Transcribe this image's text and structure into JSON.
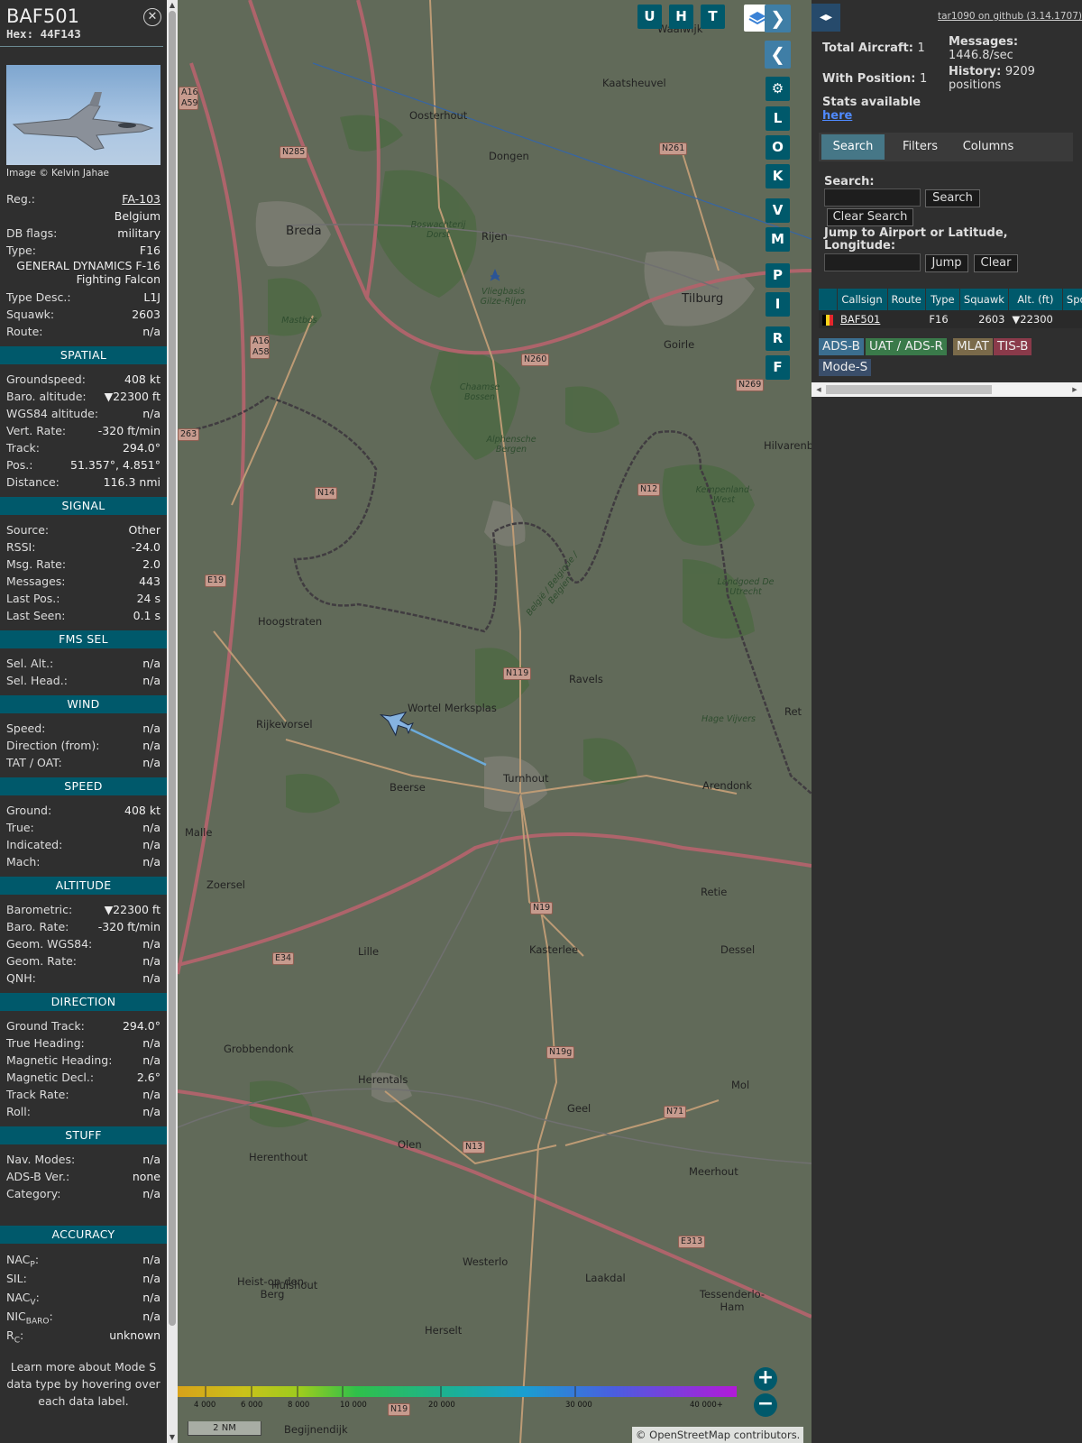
{
  "aircraft": {
    "callsign": "BAF501",
    "hex_label": "Hex: 44F143",
    "photo_credit": "Image © Kelvin Jahae",
    "rows_main": [
      {
        "label": "Reg.:",
        "value": "FA-103",
        "link": true
      },
      {
        "label": "",
        "value": "Belgium"
      },
      {
        "label": "DB flags:",
        "value": "military"
      },
      {
        "label": "Type:",
        "value": "F16"
      }
    ],
    "type_full": "GENERAL DYNAMICS F-16 Fighting Falcon",
    "rows_main2": [
      {
        "label": "Type Desc.:",
        "value": "L1J"
      },
      {
        "label": "Squawk:",
        "value": "2603"
      },
      {
        "label": "Route:",
        "value": "n/a"
      }
    ],
    "sections": [
      {
        "title": "SPATIAL",
        "rows": [
          {
            "label": "Groundspeed:",
            "value": "408 kt"
          },
          {
            "label": "Baro. altitude:",
            "value": "▼22300 ft"
          },
          {
            "label": "WGS84 altitude:",
            "value": "n/a"
          },
          {
            "label": "Vert. Rate:",
            "value": "-320 ft/min"
          },
          {
            "label": "Track:",
            "value": "294.0°"
          },
          {
            "label": "Pos.:",
            "value": "51.357°, 4.851°"
          },
          {
            "label": "Distance:",
            "value": "116.3 nmi"
          }
        ]
      },
      {
        "title": "SIGNAL",
        "rows": [
          {
            "label": "Source:",
            "value": "Other"
          },
          {
            "label": "RSSI:",
            "value": "-24.0"
          },
          {
            "label": "Msg. Rate:",
            "value": "2.0"
          },
          {
            "label": "Messages:",
            "value": "443"
          },
          {
            "label": "Last Pos.:",
            "value": "24 s"
          },
          {
            "label": "Last Seen:",
            "value": "0.1 s"
          }
        ]
      },
      {
        "title": "FMS SEL",
        "rows": [
          {
            "label": "Sel. Alt.:",
            "value": "n/a"
          },
          {
            "label": "Sel. Head.:",
            "value": "n/a"
          }
        ]
      },
      {
        "title": "WIND",
        "rows": [
          {
            "label": "Speed:",
            "value": "n/a"
          },
          {
            "label": "Direction (from):",
            "value": "n/a"
          },
          {
            "label": "TAT / OAT:",
            "value": "n/a"
          }
        ]
      },
      {
        "title": "SPEED",
        "rows": [
          {
            "label": "Ground:",
            "value": "408 kt"
          },
          {
            "label": "True:",
            "value": "n/a"
          },
          {
            "label": "Indicated:",
            "value": "n/a"
          },
          {
            "label": "Mach:",
            "value": "n/a"
          }
        ]
      },
      {
        "title": "ALTITUDE",
        "rows": [
          {
            "label": "Barometric:",
            "value": "▼22300 ft"
          },
          {
            "label": "Baro. Rate:",
            "value": "-320 ft/min"
          },
          {
            "label": "Geom. WGS84:",
            "value": "n/a"
          },
          {
            "label": "Geom. Rate:",
            "value": "n/a"
          },
          {
            "label": "QNH:",
            "value": "n/a"
          }
        ]
      },
      {
        "title": "DIRECTION",
        "rows": [
          {
            "label": "Ground Track:",
            "value": "294.0°"
          },
          {
            "label": "True Heading:",
            "value": "n/a"
          },
          {
            "label": "Magnetic Heading:",
            "value": "n/a"
          },
          {
            "label": "Magnetic Decl.:",
            "value": "2.6°"
          },
          {
            "label": "Track Rate:",
            "value": "n/a"
          },
          {
            "label": "Roll:",
            "value": "n/a"
          }
        ]
      },
      {
        "title": "STUFF",
        "rows": [
          {
            "label": "Nav. Modes:",
            "value": "n/a"
          },
          {
            "label": "ADS-B Ver.:",
            "value": "none"
          },
          {
            "label": "Category:",
            "value": "n/a"
          }
        ]
      }
    ],
    "accuracy_title": "ACCURACY",
    "accuracy": [
      {
        "label": "NAC",
        "sub": "P",
        "value": "n/a"
      },
      {
        "label": "SIL:",
        "sub": "",
        "value": "n/a"
      },
      {
        "label": "NAC",
        "sub": "V",
        "value": "n/a"
      },
      {
        "label": "NIC",
        "sub": "BARO",
        "value": "n/a"
      },
      {
        "label": "R",
        "sub": "C",
        "value": "unknown"
      }
    ],
    "footnote": "Learn more about Mode S data type by hovering over each data label."
  },
  "map": {
    "top_buttons": [
      "U",
      "H",
      "T"
    ],
    "side_buttons": [
      "L",
      "O",
      "K",
      "V",
      "M",
      "P",
      "I",
      "R",
      "F"
    ],
    "towns": [
      {
        "name": "Waalwijk"
      },
      {
        "name": "Kaatsheuvel"
      },
      {
        "name": "Oosterhout"
      },
      {
        "name": "Dongen"
      },
      {
        "name": "Breda",
        "big": true
      },
      {
        "name": "Rijen"
      },
      {
        "name": "Tilburg",
        "big": true
      },
      {
        "name": "Goirle"
      },
      {
        "name": "Hilvarenbeek"
      },
      {
        "name": "Hoogstraten"
      },
      {
        "name": "Ravels"
      },
      {
        "name": "Rijkevorsel"
      },
      {
        "name": "Wortel Merksplas"
      },
      {
        "name": "Beerse"
      },
      {
        "name": "Turnhout"
      },
      {
        "name": "Arendonk"
      },
      {
        "name": "Malle"
      },
      {
        "name": "Zoersel"
      },
      {
        "name": "Retie"
      },
      {
        "name": "Lille"
      },
      {
        "name": "Kasterlee"
      },
      {
        "name": "Dessel"
      },
      {
        "name": "Grobbendonk"
      },
      {
        "name": "Herentals"
      },
      {
        "name": "Geel"
      },
      {
        "name": "Mol"
      },
      {
        "name": "Herenthout"
      },
      {
        "name": "Olen"
      },
      {
        "name": "Meerhout"
      },
      {
        "name": "Westerlo"
      },
      {
        "name": "Laakdal"
      },
      {
        "name": "Heist-op-den-Berg"
      },
      {
        "name": "Hulshout"
      },
      {
        "name": "Tessenderlo-Ham"
      },
      {
        "name": "Herselt"
      },
      {
        "name": "Begijnendijk"
      },
      {
        "name": "Ret"
      }
    ],
    "shields": [
      "N285",
      "N261",
      "A16 A59",
      "A16 A58",
      "N260",
      "N269",
      "263",
      "N14",
      "N12",
      "E19",
      "N119",
      "N19",
      "E34",
      "N19g",
      "N71",
      "N13",
      "E313",
      "N19"
    ],
    "nature": [
      "Boswachterij Dorst",
      "Vliegbasis Gilze-Rijen",
      "Mastbos",
      "Chaamse Bossen",
      "Alphensche Bergen",
      "Kempenland-West",
      "Landgoed De Utrecht",
      "Hage Vijvers",
      "België / Belgique / Belgien"
    ],
    "altitude_legend": [
      "4 000",
      "6 000",
      "8 000",
      "10 000",
      "20 000",
      "30 000",
      "40 000+"
    ],
    "scale": "2 NM",
    "attribution_prefix": "© ",
    "attribution_link": "OpenStreetMap",
    "attribution_suffix": " contributors."
  },
  "panel": {
    "version": "tar1090 on github (3.14.1707)",
    "total_aircraft_label": "Total Aircraft:",
    "total_aircraft": "1",
    "with_position_label": "With Position:",
    "with_position": "1",
    "stats_label": "Stats available",
    "stats_link": "here",
    "messages_label": "Messages:",
    "messages_rate": "1446.8/sec",
    "history_label": "History:",
    "history_value": "9209",
    "history_unit": "positions",
    "tabs": [
      "Search",
      "Filters",
      "Columns"
    ],
    "search_label": "Search:",
    "search_button": "Search",
    "clear_search_button": "Clear Search",
    "jump_label": "Jump to Airport or Latitude, Longitude:",
    "jump_button": "Jump",
    "clear_button": "Clear",
    "table_headers": [
      "",
      "Callsign",
      "Route",
      "Type",
      "Squawk",
      "Alt. (ft)",
      "Spd"
    ],
    "table_rows": [
      {
        "callsign": "BAF501",
        "route": "",
        "type": "F16",
        "squawk": "2603",
        "alt": "▼22300",
        "spd": ""
      }
    ],
    "badges": [
      {
        "label": "ADS-B",
        "color": "#3b6e8f"
      },
      {
        "label": "UAT / ADS-R",
        "color": "#3a7a4a"
      },
      {
        "label": "MLAT",
        "color": "#7a6a4a"
      },
      {
        "label": "TIS-B",
        "color": "#8a3a4a"
      },
      {
        "label": "Mode-S",
        "color": "#3a4e6a"
      }
    ]
  }
}
